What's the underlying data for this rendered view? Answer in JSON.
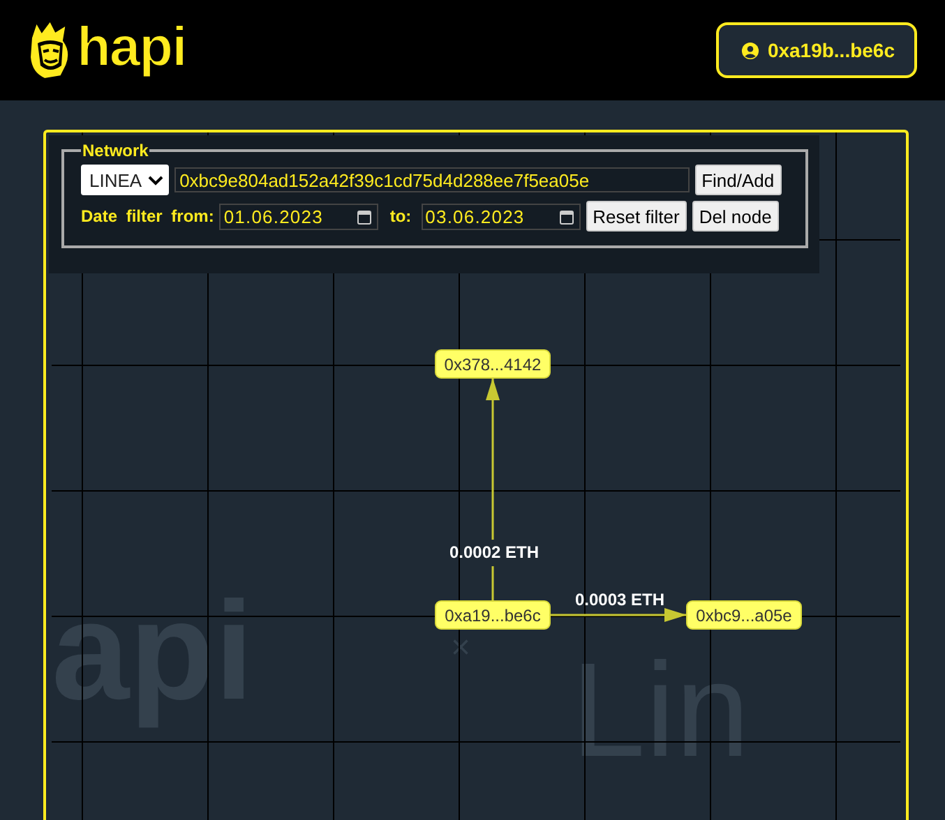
{
  "header": {
    "logo": "hapi",
    "account": "0xa19b...be6c"
  },
  "filter": {
    "legend": "Network",
    "network": "LINEA",
    "address": "0xbc9e804ad152a42f39c1cd75d4d288ee7f5ea05e",
    "find_button": "Find/Add",
    "date_label": "Date filter from:",
    "from": "01.06.2023",
    "to_label": "to:",
    "to": "03.06.2023",
    "reset_button": "Reset filter",
    "delete_button": "Del node"
  },
  "watermark": [
    "api",
    "×",
    "Lin"
  ],
  "graph": {
    "nodes": [
      {
        "label": "0x378...4142"
      },
      {
        "label": "0xa19...be6c"
      },
      {
        "label": "0xbc9...a05e"
      }
    ],
    "edges": [
      {
        "label": "0.0002 ETH"
      },
      {
        "label": "0.0003 ETH"
      }
    ]
  }
}
